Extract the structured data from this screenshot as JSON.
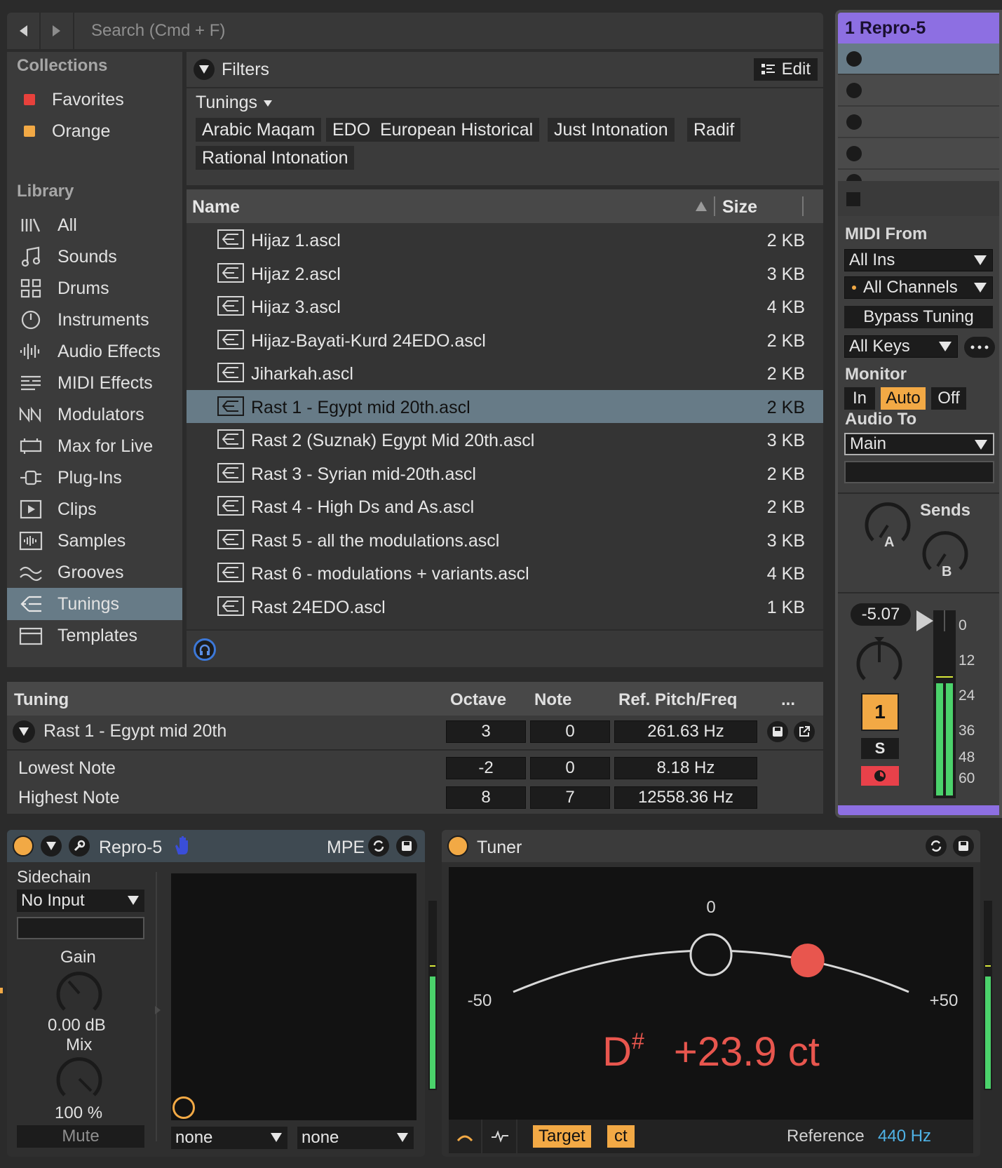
{
  "browser": {
    "search_placeholder": "Search (Cmd + F)",
    "collections_title": "Collections",
    "collections": [
      {
        "label": "Favorites",
        "color": "#e8413c"
      },
      {
        "label": "Orange",
        "color": "#f2a945"
      }
    ],
    "library_title": "Library",
    "library": [
      {
        "label": "All",
        "icon": "all-icon"
      },
      {
        "label": "Sounds",
        "icon": "music-note-icon"
      },
      {
        "label": "Drums",
        "icon": "drum-grid-icon"
      },
      {
        "label": "Instruments",
        "icon": "clock-icon"
      },
      {
        "label": "Audio Effects",
        "icon": "waveform-icon"
      },
      {
        "label": "MIDI Effects",
        "icon": "midi-effects-icon"
      },
      {
        "label": "Modulators",
        "icon": "modulators-icon"
      },
      {
        "label": "Max for Live",
        "icon": "max-icon"
      },
      {
        "label": "Plug-Ins",
        "icon": "plug-icon"
      },
      {
        "label": "Clips",
        "icon": "play-box-icon"
      },
      {
        "label": "Samples",
        "icon": "samples-icon"
      },
      {
        "label": "Grooves",
        "icon": "grooves-icon"
      },
      {
        "label": "Tunings",
        "icon": "tunings-icon"
      },
      {
        "label": "Templates",
        "icon": "templates-icon"
      }
    ],
    "filters_label": "Filters",
    "edit_label": "Edit",
    "tunings_filter_label": "Tunings",
    "tags": [
      "Arabic Maqam",
      "EDO",
      "European Historical",
      "Just Intonation",
      "Radif",
      "Rational Intonation"
    ],
    "columns": {
      "name": "Name",
      "size": "Size"
    },
    "files": [
      {
        "name": "Hijaz 1.ascl",
        "size": "2 KB"
      },
      {
        "name": "Hijaz 2.ascl",
        "size": "3 KB"
      },
      {
        "name": "Hijaz 3.ascl",
        "size": "4 KB"
      },
      {
        "name": "Hijaz-Bayati-Kurd 24EDO.ascl",
        "size": "2 KB"
      },
      {
        "name": "Jiharkah.ascl",
        "size": "2 KB"
      },
      {
        "name": "Rast 1 - Egypt mid 20th.ascl",
        "size": "2 KB"
      },
      {
        "name": "Rast 2 (Suznak) Egypt Mid 20th.ascl",
        "size": "3 KB"
      },
      {
        "name": "Rast 3 - Syrian mid-20th.ascl",
        "size": "2 KB"
      },
      {
        "name": "Rast 4 - High Ds and As.ascl",
        "size": "2 KB"
      },
      {
        "name": "Rast 5 - all the modulations.ascl",
        "size": "3 KB"
      },
      {
        "name": "Rast 6 - modulations + variants.ascl",
        "size": "4 KB"
      },
      {
        "name": "Rast 24EDO.ascl",
        "size": "1 KB"
      }
    ]
  },
  "tuning": {
    "header": {
      "tuning": "Tuning",
      "octave": "Octave",
      "note": "Note",
      "ref": "Ref. Pitch/Freq",
      "more": "..."
    },
    "name": "Rast 1 - Egypt mid 20th",
    "ref_row": {
      "octave": "3",
      "note": "0",
      "freq": "261.63 Hz"
    },
    "lowest": {
      "label": "Lowest Note",
      "octave": "-2",
      "note": "0",
      "freq": "8.18 Hz"
    },
    "highest": {
      "label": "Highest Note",
      "octave": "8",
      "note": "7",
      "freq": "12558.36 Hz"
    }
  },
  "strip": {
    "title": "1 Repro-5",
    "title_color": "#8d6fe2",
    "midi_from_label": "MIDI From",
    "midi_from": "All Ins",
    "channels": "All Channels",
    "bypass": "Bypass Tuning",
    "keys": "All Keys",
    "monitor_label": "Monitor",
    "monitor": {
      "in": "In",
      "auto": "Auto",
      "off": "Off"
    },
    "audio_to_label": "Audio To",
    "audio_to": "Main",
    "sends_label": "Sends",
    "send_a": "A",
    "send_b": "B",
    "volume": "-5.07",
    "track_number": "1",
    "solo": "S",
    "meter_ticks": [
      "0",
      "12",
      "24",
      "36",
      "48",
      "60"
    ]
  },
  "repro": {
    "title": "Repro-5",
    "mpe": "MPE",
    "sidechain_label": "Sidechain",
    "sidechain_input": "No Input",
    "gain_label": "Gain",
    "gain_value": "0.00 dB",
    "mix_label": "Mix",
    "mix_value": "100 %",
    "mute": "Mute",
    "dd1": "none",
    "dd2": "none"
  },
  "tuner": {
    "title": "Tuner",
    "scale_zero": "0",
    "scale_min": "-50",
    "scale_max": "+50",
    "note": "D",
    "accidental": "#",
    "cents": "+23.9 ct",
    "cents_value": 23.9,
    "target_label": "Target",
    "ct_label": "ct",
    "reference_label": "Reference",
    "reference_value": "440 Hz",
    "accent_color": "#e8564e"
  }
}
